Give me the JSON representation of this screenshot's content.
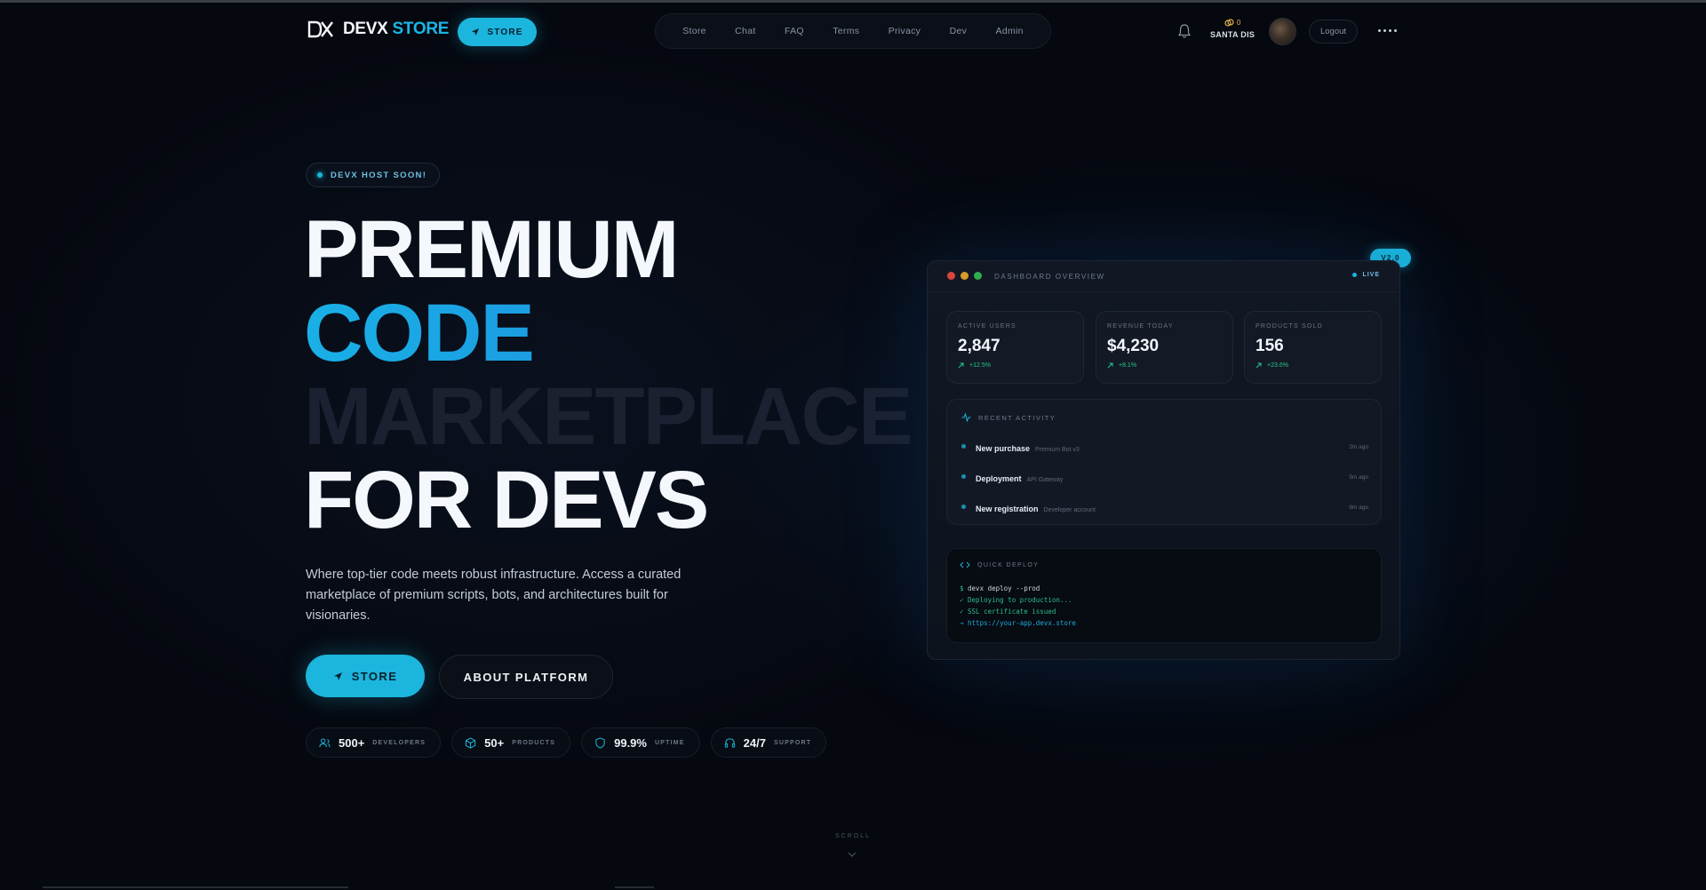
{
  "brand": {
    "logo_text_main": "DEVX",
    "logo_text_accent": "STORE"
  },
  "nav": {
    "store_button": "STORE",
    "links": [
      "Store",
      "Chat",
      "FAQ",
      "Terms",
      "Privacy",
      "Dev",
      "Admin"
    ],
    "coins": "0",
    "user_name": "SANTA DIS",
    "logout": "Logout"
  },
  "hero": {
    "badge": "DEVX HOST SOON!",
    "headline": [
      "PREMIUM",
      "CODE",
      "MARKETPLACE",
      "FOR DEVS"
    ],
    "subtitle": "Where top-tier code meets robust infrastructure. Access a curated marketplace of premium scripts, bots, and architectures built for visionaries.",
    "cta_store": "STORE",
    "cta_about": "ABOUT PLATFORM",
    "stats": [
      {
        "value": "500+",
        "label": "DEVELOPERS",
        "icon": "users-icon"
      },
      {
        "value": "50+",
        "label": "PRODUCTS",
        "icon": "box-icon"
      },
      {
        "value": "99.9%",
        "label": "UPTIME",
        "icon": "shield-icon"
      },
      {
        "value": "24/7",
        "label": "SUPPORT",
        "icon": "headphones-icon"
      }
    ],
    "scroll": "SCROLL"
  },
  "dashboard": {
    "version": "V2.0",
    "title": "DASHBOARD OVERVIEW",
    "live": "LIVE",
    "kpis": [
      {
        "label": "ACTIVE USERS",
        "value": "2,847",
        "delta": "+12.5%"
      },
      {
        "label": "REVENUE TODAY",
        "value": "$4,230",
        "delta": "+8.1%"
      },
      {
        "label": "PRODUCTS SOLD",
        "value": "156",
        "delta": "+23.6%"
      }
    ],
    "activity": {
      "title": "RECENT ACTIVITY",
      "items": [
        {
          "title": "New purchase",
          "detail": "Premium Bot v3",
          "time": "2m ago"
        },
        {
          "title": "Deployment",
          "detail": "API Gateway",
          "time": "5m ago"
        },
        {
          "title": "New registration",
          "detail": "Developer account",
          "time": "8m ago"
        }
      ]
    },
    "deploy": {
      "title": "QUICK DEPLOY",
      "cmd_prefix": "$",
      "cmd": "devx deploy --prod",
      "lines": [
        "✓ Deploying to production...",
        "✓ SSL certificate issued",
        "→ https://your-app.devx.store"
      ]
    }
  },
  "colors": {
    "accent": "#1bb5dd",
    "background": "#05080f",
    "positive": "#24c98a"
  }
}
